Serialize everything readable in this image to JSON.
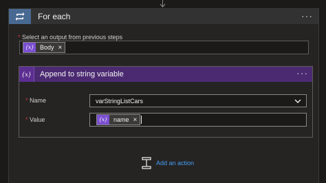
{
  "foreach": {
    "title": "For each",
    "more": "···",
    "select_label": "Select an output from previous steps",
    "required_mark": "*",
    "token": {
      "icon": "{x}",
      "label": "Body",
      "remove": "×"
    }
  },
  "append": {
    "title": "Append to string variable",
    "more": "···",
    "name_label": "Name",
    "name_value": "varStringListCars",
    "value_label": "Value",
    "value_token": {
      "icon": "{x}",
      "label": "name",
      "remove": "×"
    },
    "required_mark": "*"
  },
  "add_action": {
    "label": "Add an action"
  },
  "colors": {
    "foreach_accent": "#486991",
    "variable_purple": "#5c2e91",
    "token_purple": "#7b4fd1",
    "link_blue": "#479ef5"
  },
  "icons": {
    "foreach": "loop-icon",
    "variable": "variable-icon",
    "dropdown": "chevron-down-icon",
    "add_action": "add-action-icon"
  }
}
